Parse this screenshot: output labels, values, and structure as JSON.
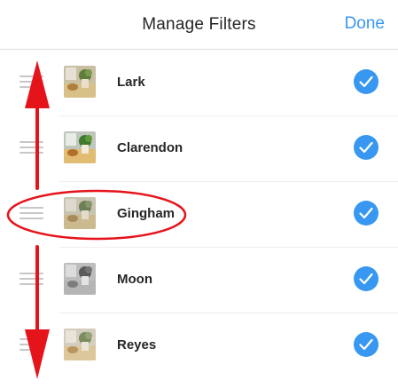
{
  "header": {
    "title": "Manage Filters",
    "done_label": "Done"
  },
  "colors": {
    "accent": "#3897f0",
    "annotation": "#e5141b",
    "handle": "#c7c7c7"
  },
  "filters": [
    {
      "name": "Lark",
      "checked": true,
      "thumb_tone": "warm"
    },
    {
      "name": "Clarendon",
      "checked": true,
      "thumb_tone": "warm"
    },
    {
      "name": "Gingham",
      "checked": true,
      "thumb_tone": "faded"
    },
    {
      "name": "Moon",
      "checked": true,
      "thumb_tone": "mono"
    },
    {
      "name": "Reyes",
      "checked": true,
      "thumb_tone": "faded"
    }
  ],
  "icons": {
    "drag": "drag-handle-icon",
    "check": "checkmark-icon"
  }
}
